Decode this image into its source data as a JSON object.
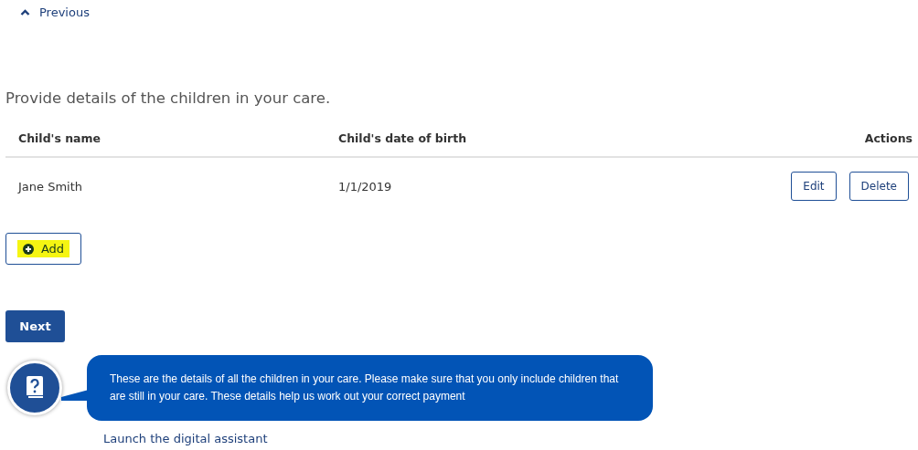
{
  "back_link": {
    "label": "Previous"
  },
  "heading": "Provide details of the children in your care.",
  "table": {
    "columns": [
      "Child's name",
      "Child's date of birth",
      "Actions"
    ],
    "rows": [
      {
        "name": "Jane Smith",
        "date_of_birth": "1/1/2019",
        "actions": [
          "Edit",
          "Delete"
        ]
      }
    ]
  },
  "add_button": {
    "label": "Add",
    "highlighted": true
  },
  "next_button": {
    "label": "Next"
  },
  "assistant": {
    "message": "These are the details of all the children in your care. Please make sure that you only include children that are still in your care. These details help us work out your correct payment",
    "link": "Launch the digital assistant"
  }
}
